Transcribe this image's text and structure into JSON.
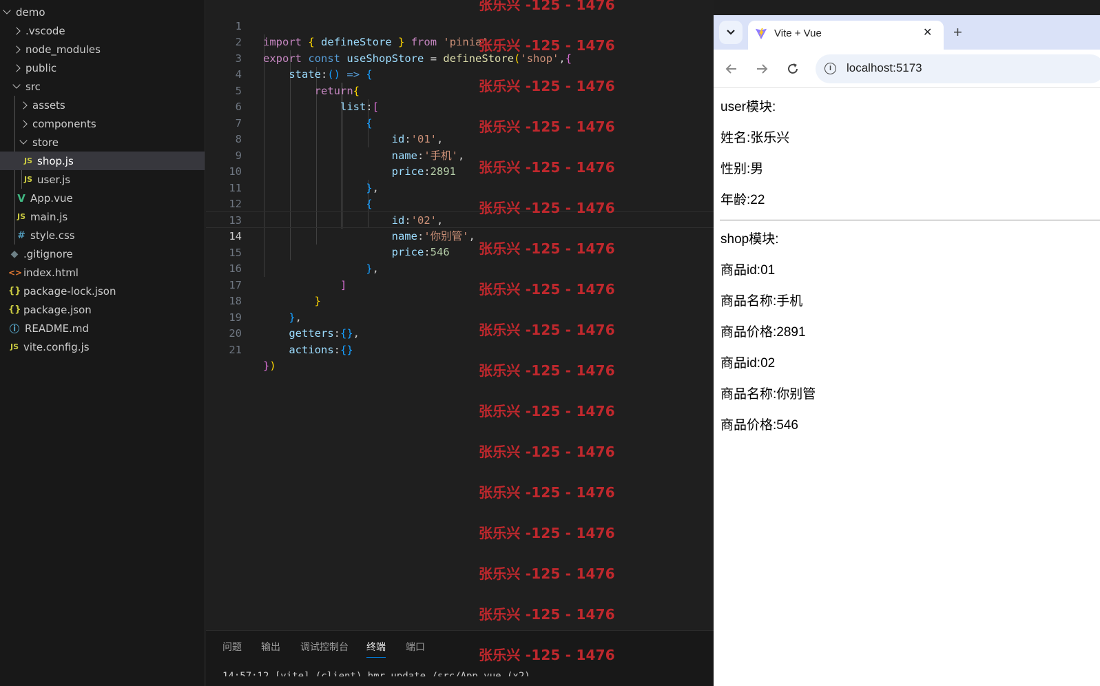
{
  "explorer": {
    "root": "demo",
    "items": [
      {
        "label": ".vscode",
        "kind": "folder",
        "icon": "chevron-right-icon"
      },
      {
        "label": "node_modules",
        "kind": "folder",
        "icon": "chevron-right-icon"
      },
      {
        "label": "public",
        "kind": "folder",
        "icon": "chevron-right-icon"
      },
      {
        "label": "src",
        "kind": "folder",
        "icon": "chevron-down-icon"
      },
      {
        "label": "assets",
        "kind": "folder",
        "icon": "chevron-right-icon"
      },
      {
        "label": "components",
        "kind": "folder",
        "icon": "chevron-right-icon"
      },
      {
        "label": "store",
        "kind": "folder",
        "icon": "chevron-down-icon"
      },
      {
        "label": "shop.js",
        "kind": "file",
        "icon": "js-file-icon",
        "badge": "JS"
      },
      {
        "label": "user.js",
        "kind": "file",
        "icon": "js-file-icon",
        "badge": "JS"
      },
      {
        "label": "App.vue",
        "kind": "file",
        "icon": "vue-file-icon",
        "badge": "V"
      },
      {
        "label": "main.js",
        "kind": "file",
        "icon": "js-file-icon",
        "badge": "JS"
      },
      {
        "label": "style.css",
        "kind": "file",
        "icon": "css-file-icon",
        "badge": "#"
      },
      {
        "label": ".gitignore",
        "kind": "file",
        "icon": "git-file-icon",
        "badge": "◆"
      },
      {
        "label": "index.html",
        "kind": "file",
        "icon": "html-file-icon",
        "badge": "<>"
      },
      {
        "label": "package-lock.json",
        "kind": "file",
        "icon": "json-file-icon",
        "badge": "{}"
      },
      {
        "label": "package.json",
        "kind": "file",
        "icon": "json-file-icon",
        "badge": "{}"
      },
      {
        "label": "README.md",
        "kind": "file",
        "icon": "info-file-icon",
        "badge": "i"
      },
      {
        "label": "vite.config.js",
        "kind": "file",
        "icon": "js-file-icon",
        "badge": "JS"
      }
    ],
    "selected": "shop.js"
  },
  "editor": {
    "current_line": 14,
    "line_numbers": [
      "1",
      "2",
      "3",
      "4",
      "5",
      "6",
      "7",
      "8",
      "9",
      "10",
      "11",
      "12",
      "13",
      "14",
      "15",
      "16",
      "17",
      "18",
      "19",
      "20",
      "21"
    ],
    "code": {
      "l1": {
        "import": "import",
        "b_open": "{",
        "name": "defineStore",
        "b_close": "}",
        "from": "from",
        "mod": "'pinia'"
      },
      "l2": {
        "export": "export",
        "const": "const",
        "name": "useShopStore",
        "eq": "=",
        "fn": "defineStore",
        "po": "(",
        "id": "'shop'",
        "comma": ",",
        "bo": "{"
      },
      "l3": {
        "key": "state",
        "colon": ":",
        "paren": "()",
        "arrow": "=>",
        "bo": "{"
      },
      "l4": {
        "ret": "return",
        "bo": "{"
      },
      "l5": {
        "key": "list",
        "colon": ":",
        "bo": "["
      },
      "l6": {
        "bo": "{"
      },
      "l7": {
        "key": "id",
        "colon": ":",
        "val": "'01'",
        "comma": ","
      },
      "l8": {
        "key": "name",
        "colon": ":",
        "val": "'手机'",
        "comma": ","
      },
      "l9": {
        "key": "price",
        "colon": ":",
        "val": "2891"
      },
      "l10": {
        "bc": "}",
        "comma": ","
      },
      "l11": {
        "bo": "{"
      },
      "l12": {
        "key": "id",
        "colon": ":",
        "val": "'02'",
        "comma": ","
      },
      "l13": {
        "key": "name",
        "colon": ":",
        "val": "'你别管'",
        "comma": ","
      },
      "l14": {
        "key": "price",
        "colon": ":",
        "val": "546"
      },
      "l15": {
        "bc": "}",
        "comma": ","
      },
      "l16": {
        "bc": "]"
      },
      "l17": {
        "bc": "}"
      },
      "l18": {
        "bc": "}",
        "comma": ","
      },
      "l19": {
        "key": "getters",
        "colon": ":",
        "braces": "{}",
        "comma": ","
      },
      "l20": {
        "key": "actions",
        "colon": ":",
        "braces": "{}"
      },
      "l21": {
        "bc": "}",
        "pc": ")"
      }
    }
  },
  "panel": {
    "tabs": [
      "问题",
      "输出",
      "调试控制台",
      "终端",
      "端口"
    ],
    "active_tab": "终端",
    "terminal_cut_line": "14:57:12 [vite] (client) hmr update /src/App.vue (x2)"
  },
  "watermark": {
    "text": "张乐兴 -125 - 1476",
    "count": 17
  },
  "browser": {
    "tab_title": "Vite + Vue",
    "close_glyph": "✕",
    "new_tab_glyph": "+",
    "url": "localhost:5173",
    "page": {
      "user_heading": "user模块:",
      "user_name": "姓名:张乐兴",
      "user_gender": "性别:男",
      "user_age": "年龄:22",
      "shop_heading": "shop模块:",
      "items": [
        {
          "id": "商品id:01",
          "name": "商品名称:手机",
          "price": "商品价格:2891"
        },
        {
          "id": "商品id:02",
          "name": "商品名称:你别管",
          "price": "商品价格:546"
        }
      ]
    }
  },
  "colors": {
    "editor_bg": "#1f1f1f",
    "sidebar_bg": "#181818",
    "watermark": "#c0282d",
    "accent": "#0078d4",
    "tabstrip": "#dae2f8"
  }
}
